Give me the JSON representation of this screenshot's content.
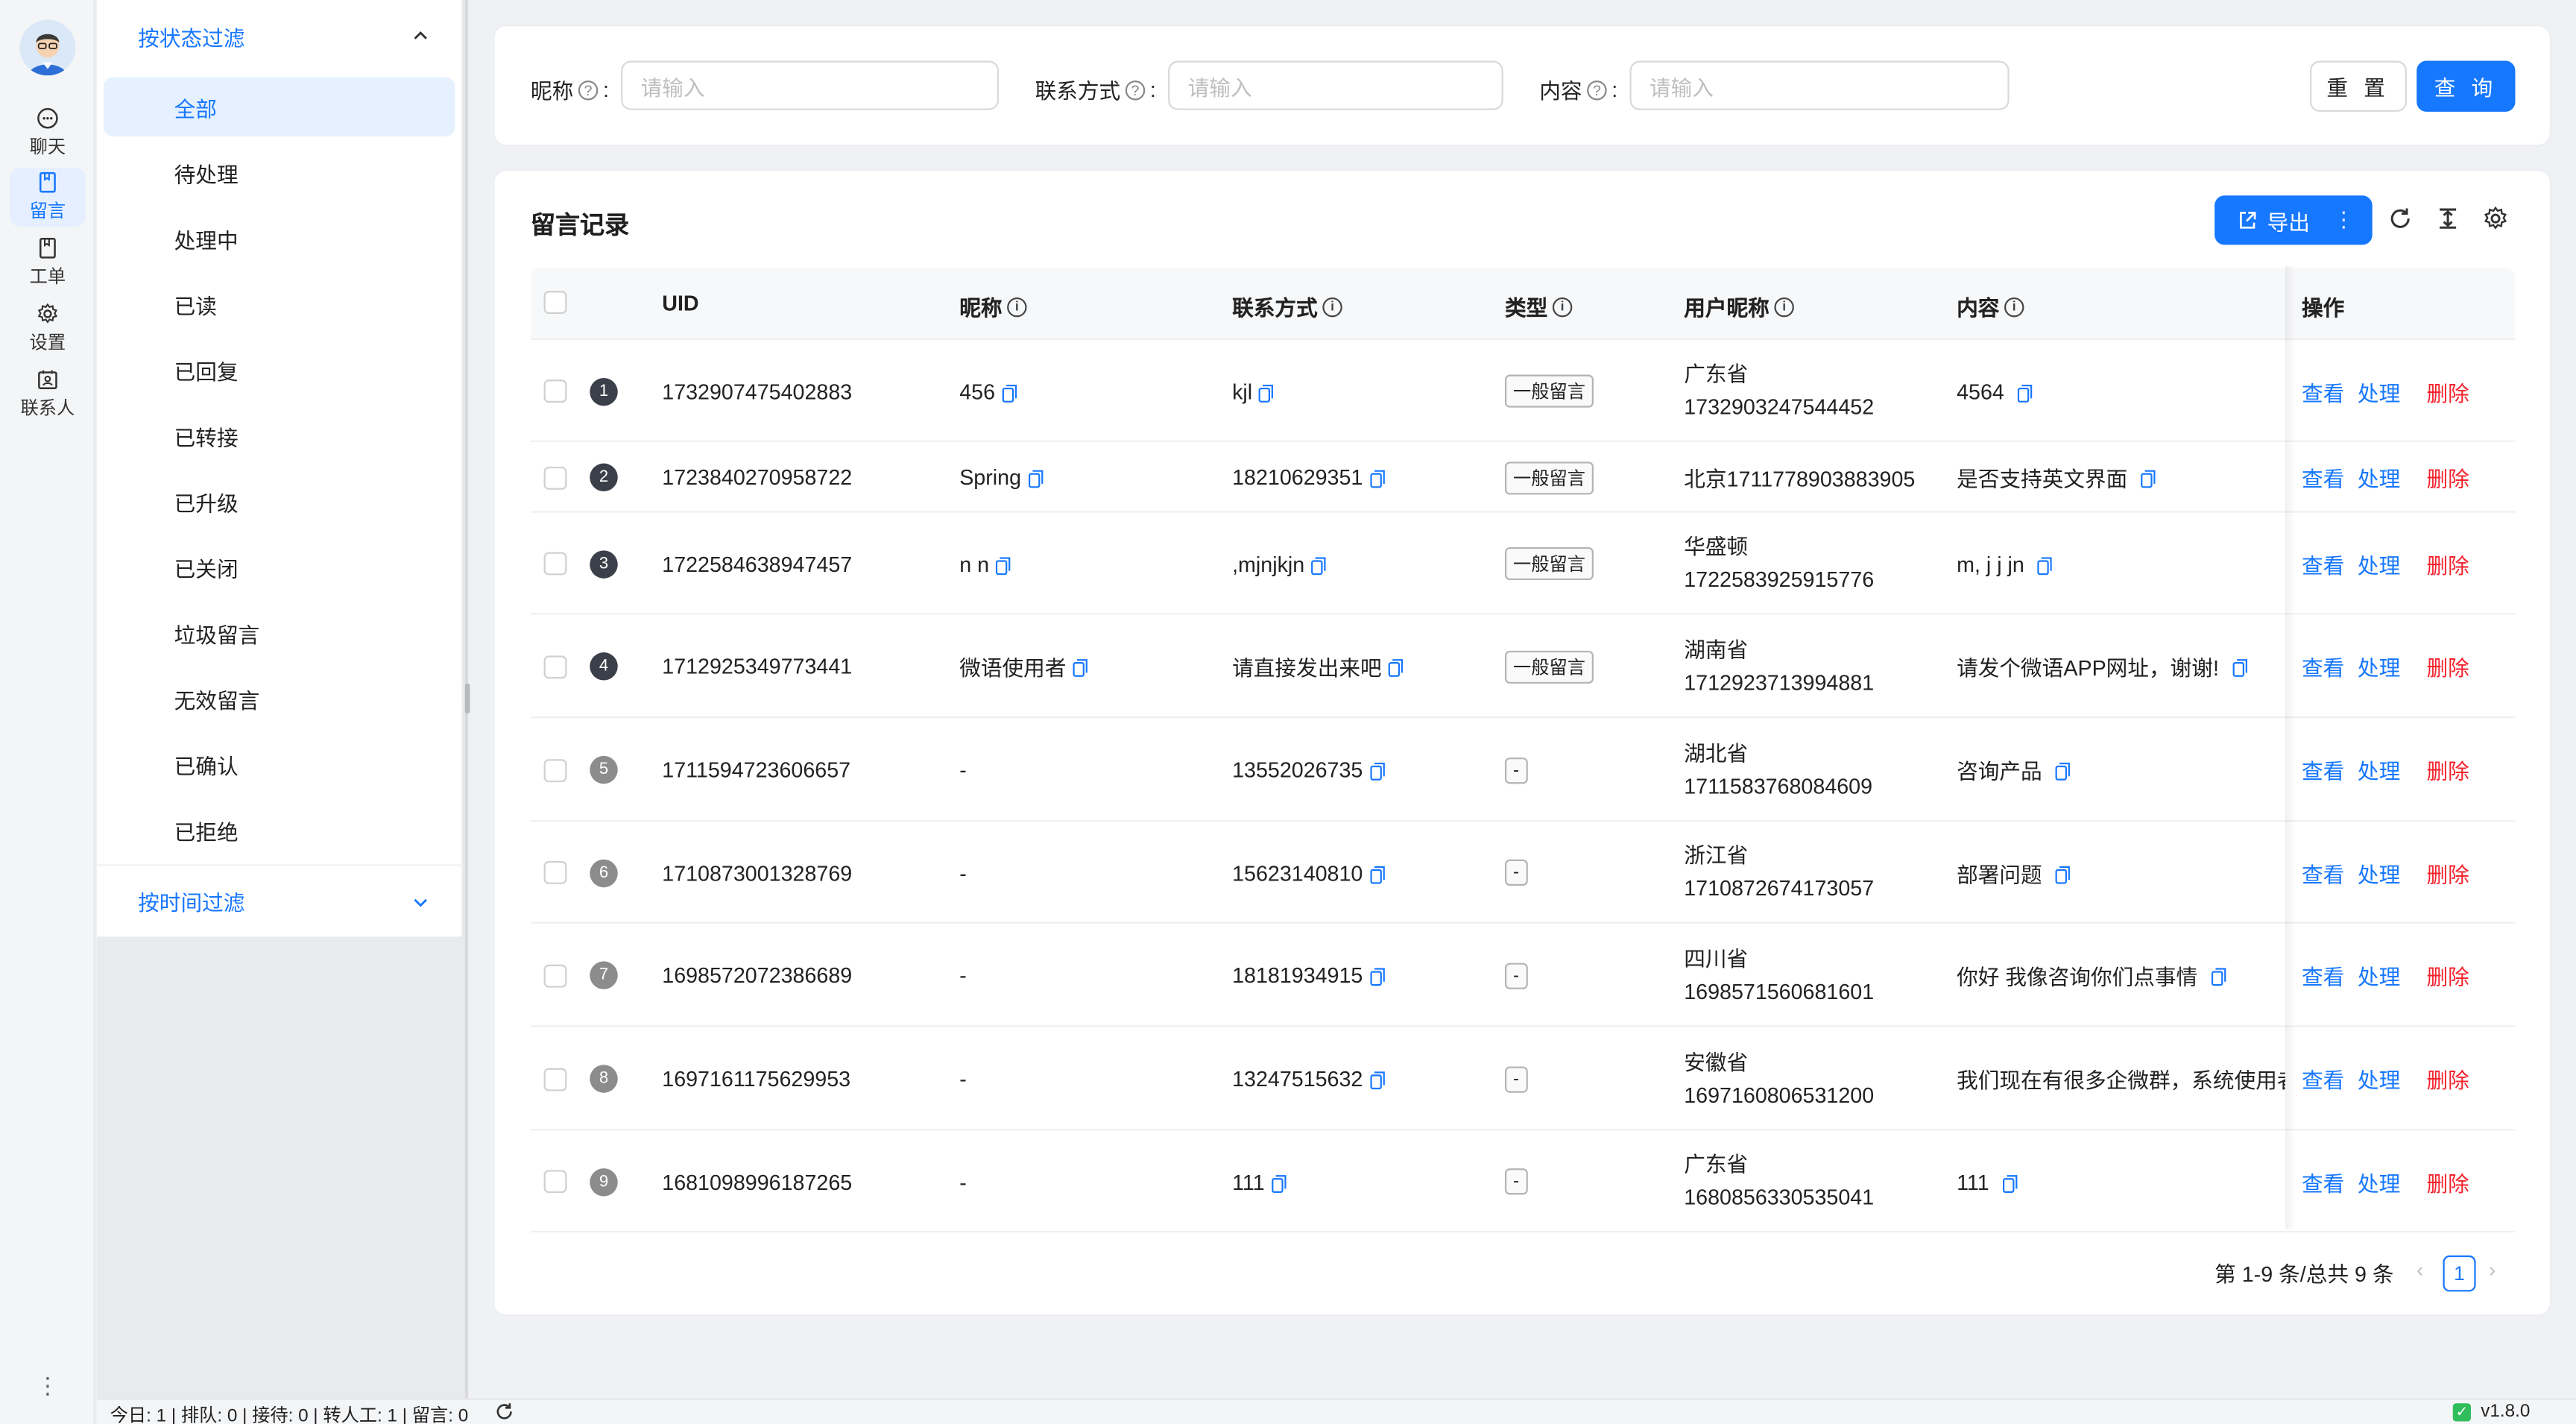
{
  "rail": {
    "items": [
      {
        "label": "聊天",
        "icon": "chat-icon"
      },
      {
        "label": "留言",
        "icon": "message-icon"
      },
      {
        "label": "工单",
        "icon": "ticket-icon"
      },
      {
        "label": "设置",
        "icon": "gear-icon"
      },
      {
        "label": "联系人",
        "icon": "contacts-icon"
      }
    ],
    "more": "⋮"
  },
  "filters": {
    "status_group": "按状态过滤",
    "time_group": "按时间过滤",
    "status_items": [
      "全部",
      "待处理",
      "处理中",
      "已读",
      "已回复",
      "已转接",
      "已升级",
      "已关闭",
      "垃圾留言",
      "无效留言",
      "已确认",
      "已拒绝"
    ]
  },
  "search": {
    "nickname_label": "昵称",
    "contact_label": "联系方式",
    "content_label": "内容",
    "placeholder": "请输入",
    "reset": "重 置",
    "query": "查 询"
  },
  "table": {
    "title": "留言记录",
    "export": "导出",
    "columns": {
      "uid": "UID",
      "nickname": "昵称",
      "contact": "联系方式",
      "type": "类型",
      "user_nickname": "用户昵称",
      "content": "内容",
      "ops": "操作"
    },
    "actions": {
      "view": "查看",
      "handle": "处理",
      "delete": "删除"
    },
    "rows": [
      {
        "no": "1",
        "uid": "1732907475402883",
        "nickname": "456",
        "contact": "kjl",
        "type": "一般留言",
        "user1": "广东省",
        "user2": "1732903247544452",
        "content": "4564"
      },
      {
        "no": "2",
        "uid": "1723840270958722",
        "nickname": "Spring",
        "contact": "18210629351",
        "type": "一般留言",
        "user1": "北京1711778903883905",
        "user2": "",
        "content": "是否支持英文界面"
      },
      {
        "no": "3",
        "uid": "1722584638947457",
        "nickname": "n n",
        "contact": ",mjnjkjn",
        "type": "一般留言",
        "user1": "华盛顿",
        "user2": "1722583925915776",
        "content": "m, j j jn"
      },
      {
        "no": "4",
        "uid": "1712925349773441",
        "nickname": "微语使用者",
        "contact": "请直接发出来吧",
        "type": "一般留言",
        "user1": "湖南省",
        "user2": "1712923713994881",
        "content": "请发个微语APP网址，谢谢!"
      },
      {
        "no": "5",
        "uid": "1711594723606657",
        "nickname": "-",
        "contact": "13552026735",
        "type": "-",
        "user1": "湖北省",
        "user2": "1711583768084609",
        "content": "咨询产品"
      },
      {
        "no": "6",
        "uid": "1710873001328769",
        "nickname": "-",
        "contact": "15623140810",
        "type": "-",
        "user1": "浙江省",
        "user2": "1710872674173057",
        "content": "部署问题"
      },
      {
        "no": "7",
        "uid": "1698572072386689",
        "nickname": "-",
        "contact": "18181934915",
        "type": "-",
        "user1": "四川省",
        "user2": "1698571560681601",
        "content": "你好 我像咨询你们点事情"
      },
      {
        "no": "8",
        "uid": "1697161175629953",
        "nickname": "-",
        "contact": "13247515632",
        "type": "-",
        "user1": "安徽省",
        "user2": "1697160806531200",
        "content": "我们现在有很多企微群，系统使用者"
      },
      {
        "no": "9",
        "uid": "1681098996187265",
        "nickname": "-",
        "contact": "111",
        "type": "-",
        "user1": "广东省",
        "user2": "1680856330535041",
        "content": "111"
      }
    ],
    "pagination": {
      "summary": "第 1-9 条/总共 9 条",
      "page": "1"
    }
  },
  "statusbar": {
    "text": "今日: 1 | 排队: 0 | 接待: 0 | 转人工: 1 | 留言: 0",
    "version": "v1.8.0"
  },
  "colors": {
    "accent": "#1677ff",
    "danger": "#f5222d",
    "ok": "#2fbe5b"
  }
}
